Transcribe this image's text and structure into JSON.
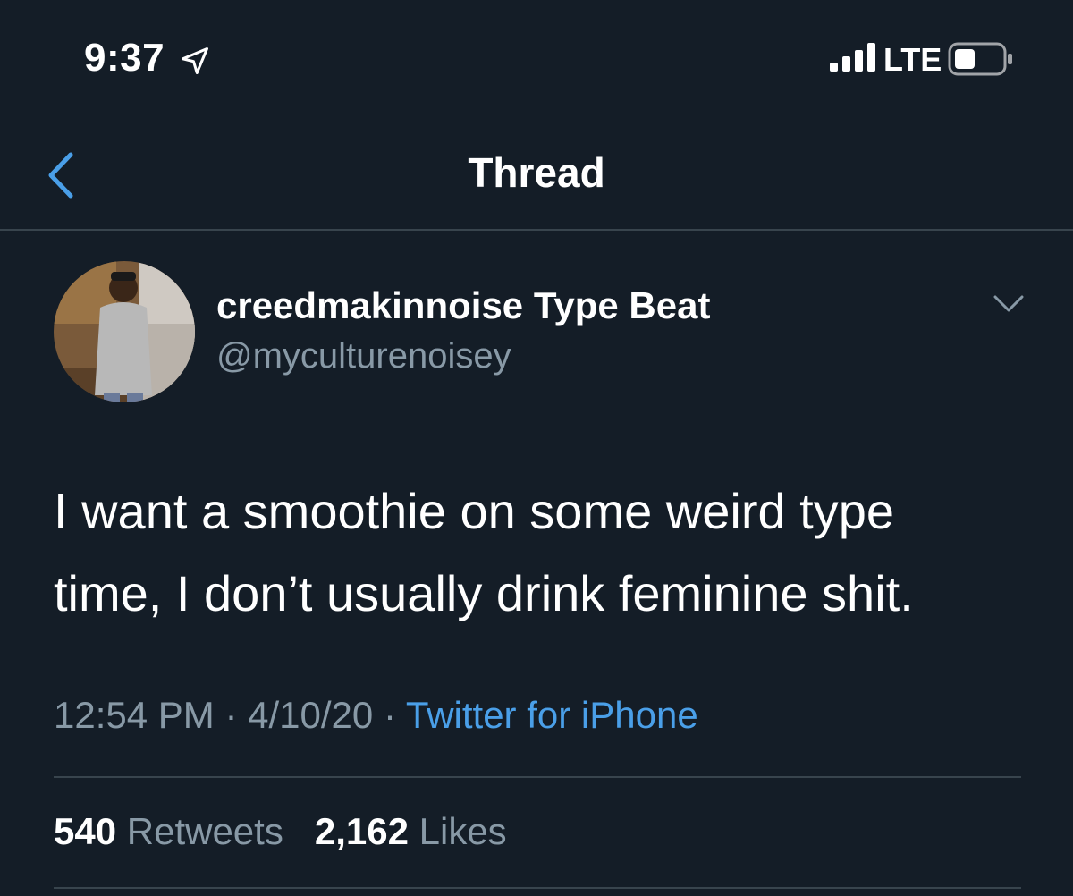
{
  "status_bar": {
    "time": "9:37",
    "network": "LTE",
    "icons": [
      "location-arrow-icon",
      "signal-bars-icon",
      "battery-icon"
    ]
  },
  "nav": {
    "title": "Thread",
    "back_icon": "chevron-left-icon"
  },
  "tweet": {
    "display_name": "creedmakinnoise Type Beat",
    "handle": "@myculturenoisey",
    "text_line_1": "I want a smoothie on some weird type",
    "text_line_2": "time, I don’t usually drink feminine shit.",
    "time": "12:54 PM",
    "separator": "·",
    "date": "4/10/20",
    "source": "Twitter for iPhone",
    "retweets_count": "540",
    "retweets_label": "Retweets",
    "likes_count": "2,162",
    "likes_label": "Likes"
  },
  "colors": {
    "background": "#141d27",
    "accent": "#4a9fe8",
    "secondary_text": "#8899a6",
    "divider": "#38444d"
  }
}
